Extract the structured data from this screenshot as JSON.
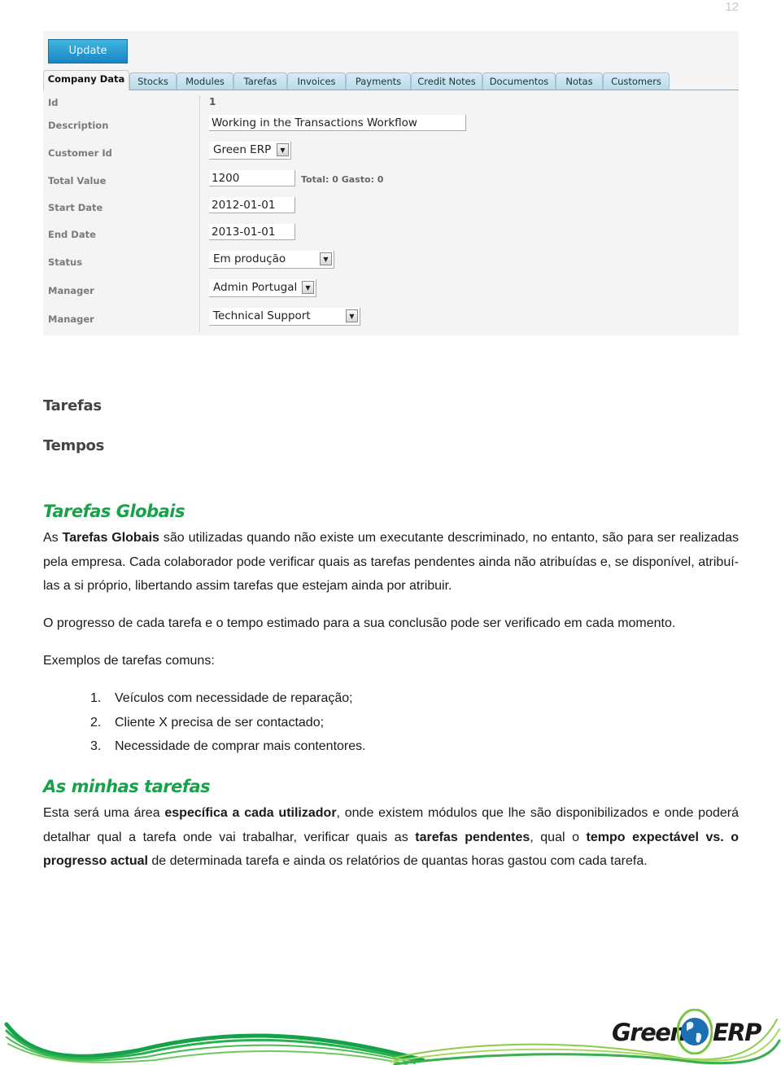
{
  "page_number": "12",
  "app": {
    "update_button": "Update",
    "tabs": [
      {
        "label": "Company Data",
        "active": true
      },
      {
        "label": "Stocks"
      },
      {
        "label": "Modules"
      },
      {
        "label": "Tarefas"
      },
      {
        "label": "Invoices"
      },
      {
        "label": "Payments"
      },
      {
        "label": "Credit Notes"
      },
      {
        "label": "Documentos"
      },
      {
        "label": "Notas"
      },
      {
        "label": "Customers"
      }
    ],
    "form": {
      "id": {
        "label": "Id",
        "value": "1"
      },
      "description": {
        "label": "Description",
        "value": "Working in the Transactions Workflow"
      },
      "customer_id": {
        "label": "Customer Id",
        "value": "Green ERP"
      },
      "total_value": {
        "label": "Total Value",
        "value": "1200",
        "summary": "Total: 0  Gasto: 0"
      },
      "start_date": {
        "label": "Start Date",
        "value": "2012-01-01"
      },
      "end_date": {
        "label": "End Date",
        "value": "2013-01-01"
      },
      "status": {
        "label": "Status",
        "value": "Em produção"
      },
      "manager1": {
        "label": "Manager",
        "value": "Admin Portugal"
      },
      "manager2": {
        "label": "Manager",
        "value": "Technical Support"
      }
    }
  },
  "doc": {
    "heading_tarefas": "Tarefas",
    "heading_tempos": "Tempos",
    "section1": {
      "title": "Tarefas Globais",
      "p1_pre": "As ",
      "p1_bold": "Tarefas Globais",
      "p1_post": " são utilizadas quando não existe um executante descriminado, no entanto, são para ser realizadas pela empresa. Cada colaborador pode verificar quais as tarefas pendentes ainda não atribuídas e, se disponível, atribuí-las a si próprio, libertando assim tarefas que estejam ainda por atribuir.",
      "p2": "O progresso de cada tarefa e o tempo estimado para a sua conclusão pode ser verificado em cada momento.",
      "p3": "Exemplos de tarefas comuns:",
      "examples": [
        {
          "num": "1.",
          "text": "Veículos com necessidade de reparação;"
        },
        {
          "num": "2.",
          "text": "Cliente X precisa de ser contactado;"
        },
        {
          "num": "3.",
          "text": "Necessidade de comprar mais contentores."
        }
      ]
    },
    "section2": {
      "title": "As minhas tarefas",
      "t1": "Esta será uma área ",
      "b1": "específica a cada utilizador",
      "t2": ", onde existem módulos que lhe são disponibilizados e onde poderá detalhar qual a tarefa onde vai trabalhar, verificar quais as ",
      "b2": "tarefas pendentes",
      "t3": ", qual o ",
      "b3": "tempo expectável vs. o progresso actual",
      "t4": " de determinada tarefa e ainda os relatórios de quantas horas gastou com cada tarefa."
    }
  },
  "footer": {
    "logo_left": "Green",
    "logo_right": "ERP",
    "brand_green": "#17a24a",
    "globe_blue": "#1b6fb3"
  }
}
